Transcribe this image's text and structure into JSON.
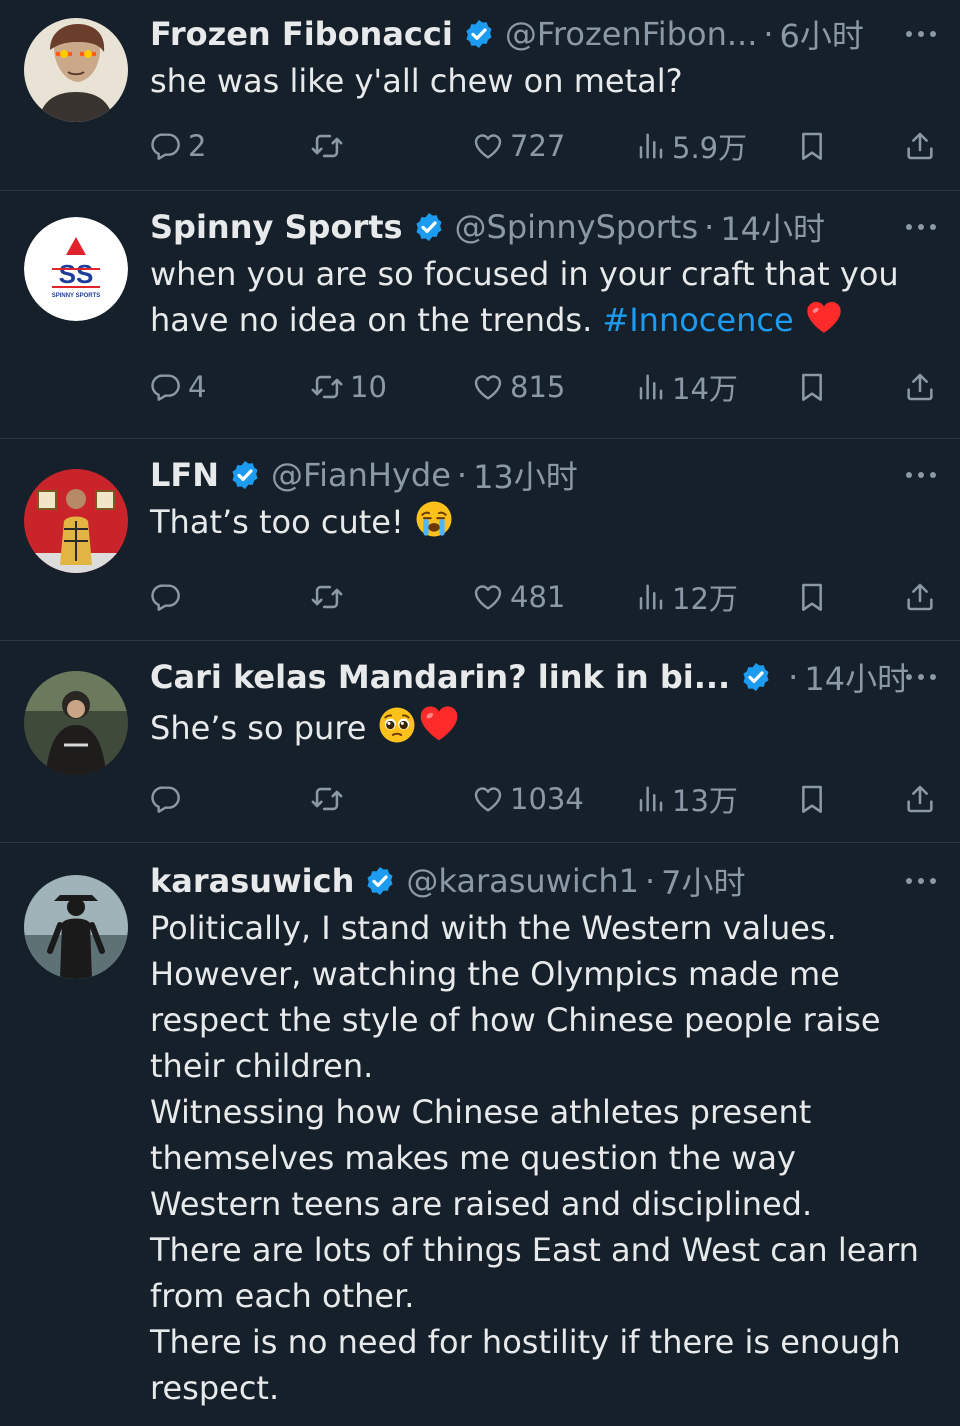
{
  "tweets": [
    {
      "name": "Frozen Fibonacci",
      "handle": "@FrozenFibon...",
      "sep": "·",
      "time": "6小时",
      "text": "she was like y'all chew on metal?",
      "replies": "2",
      "retweets": "",
      "likes": "727",
      "views": "5.9万"
    },
    {
      "name": "Spinny Sports",
      "handle": "@SpinnySports",
      "sep": "·",
      "time": "14小时",
      "text_part1": "when you are so focused in your craft that you have no idea on the trends.",
      "hashtag": "#Innocence",
      "replies": "4",
      "retweets": "10",
      "likes": "815",
      "views": "14万",
      "avatar_logo_text": "SS",
      "avatar_logo_subtext": "SPINNY SPORTS"
    },
    {
      "name": "LFN",
      "handle": "@FianHyde",
      "sep": "·",
      "time": "13小时",
      "text": "That’s too cute!",
      "replies": "",
      "retweets": "",
      "likes": "481",
      "views": "12万"
    },
    {
      "name": "Cari kelas Mandarin? link in bi...",
      "handle": "",
      "sep": "·",
      "time": "14小时",
      "text": "She’s so pure",
      "replies": "",
      "retweets": "",
      "likes": "1034",
      "views": "13万"
    },
    {
      "name": "karasuwich",
      "handle": "@karasuwich1",
      "sep": "·",
      "time": "7小时",
      "lines": [
        "Politically, I stand with the Western values. However, watching the Olympics made me respect the style of how Chinese people raise their children.",
        "Witnessing how Chinese athletes present themselves makes me question the way Western teens are raised and disciplined.",
        "There are lots of things East and West can learn from each other.",
        "There is no need for hostility if there is enough respect."
      ]
    }
  ],
  "colors": {
    "background": "#15202b",
    "text": "#e7e9ea",
    "muted": "#8b98a5",
    "accent": "#1d9bf0",
    "divider": "#2a3640"
  },
  "icons": [
    "verified-badge-icon",
    "more-icon",
    "reply-icon",
    "retweet-icon",
    "like-icon",
    "views-icon",
    "bookmark-icon",
    "share-icon",
    "red-heart-emoji",
    "crying-face-emoji",
    "pleading-face-emoji"
  ]
}
